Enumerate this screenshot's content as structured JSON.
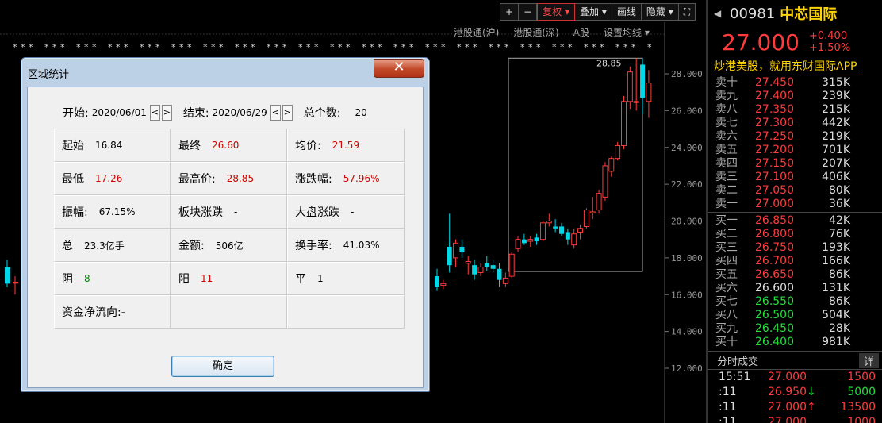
{
  "toolbar": {
    "plus": "+",
    "minus": "−",
    "fuquan": "复权",
    "diejia": "叠加",
    "huaxian": "画线",
    "yincang": "隐藏",
    "fullscreen_icon": "fullscreen-icon"
  },
  "chart_sub": {
    "hk_sh": "港股通(沪)",
    "hk_sz": "港股通(深)",
    "a_share": "A股",
    "set_ma": "设置均线"
  },
  "chart_data": {
    "type": "candlestick",
    "y_ticks": [
      "28.000",
      "26.000",
      "24.000",
      "22.000",
      "20.000",
      "18.000",
      "16.000",
      "14.000",
      "12.000"
    ],
    "ylim": [
      12,
      28.85
    ],
    "high_label": "28.85",
    "up_color": "#ff3b3b",
    "down_color": "#00d8e8",
    "candles": [
      {
        "o": 17.0,
        "h": 17.4,
        "l": 16.2,
        "c": 16.4
      },
      {
        "o": 16.5,
        "h": 16.8,
        "l": 16.3,
        "c": 16.6
      },
      {
        "o": 18.6,
        "h": 20.4,
        "l": 17.2,
        "c": 17.6
      },
      {
        "o": 18.0,
        "h": 19.0,
        "l": 17.5,
        "c": 18.8
      },
      {
        "o": 18.6,
        "h": 19.0,
        "l": 18.0,
        "c": 18.3
      },
      {
        "o": 17.7,
        "h": 18.1,
        "l": 17.1,
        "c": 17.8
      },
      {
        "o": 17.6,
        "h": 17.9,
        "l": 16.8,
        "c": 17.1
      },
      {
        "o": 17.2,
        "h": 17.7,
        "l": 17.0,
        "c": 17.5
      },
      {
        "o": 17.7,
        "h": 18.1,
        "l": 17.3,
        "c": 17.5
      },
      {
        "o": 17.6,
        "h": 17.9,
        "l": 17.2,
        "c": 17.4
      },
      {
        "o": 17.4,
        "h": 17.7,
        "l": 16.4,
        "c": 16.8
      },
      {
        "o": 16.6,
        "h": 17.2,
        "l": 16.4,
        "c": 16.9
      },
      {
        "o": 17.0,
        "h": 18.3,
        "l": 16.9,
        "c": 18.2
      },
      {
        "o": 18.5,
        "h": 19.2,
        "l": 18.3,
        "c": 19.0
      },
      {
        "o": 19.0,
        "h": 19.3,
        "l": 18.7,
        "c": 18.8
      },
      {
        "o": 18.9,
        "h": 19.2,
        "l": 18.6,
        "c": 19.0
      },
      {
        "o": 19.1,
        "h": 19.3,
        "l": 18.7,
        "c": 18.9
      },
      {
        "o": 19.0,
        "h": 20.0,
        "l": 18.9,
        "c": 19.9
      },
      {
        "o": 19.9,
        "h": 20.4,
        "l": 19.7,
        "c": 20.0
      },
      {
        "o": 19.7,
        "h": 20.1,
        "l": 19.4,
        "c": 19.6
      },
      {
        "o": 19.7,
        "h": 19.9,
        "l": 19.2,
        "c": 19.3
      },
      {
        "o": 19.4,
        "h": 19.6,
        "l": 18.7,
        "c": 19.0
      },
      {
        "o": 18.7,
        "h": 19.6,
        "l": 18.5,
        "c": 19.3
      },
      {
        "o": 19.4,
        "h": 19.8,
        "l": 19.0,
        "c": 19.6
      },
      {
        "o": 19.7,
        "h": 20.7,
        "l": 19.6,
        "c": 20.6
      },
      {
        "o": 20.5,
        "h": 21.3,
        "l": 20.1,
        "c": 20.5
      },
      {
        "o": 20.6,
        "h": 21.7,
        "l": 20.4,
        "c": 21.5
      },
      {
        "o": 21.3,
        "h": 23.2,
        "l": 21.1,
        "c": 23.0
      },
      {
        "o": 22.7,
        "h": 23.5,
        "l": 22.4,
        "c": 23.4
      },
      {
        "o": 23.4,
        "h": 24.3,
        "l": 23.3,
        "c": 24.1
      },
      {
        "o": 24.1,
        "h": 26.8,
        "l": 23.9,
        "c": 26.5
      },
      {
        "o": 26.5,
        "h": 28.4,
        "l": 26.1,
        "c": 28.1
      },
      {
        "o": 26.5,
        "h": 28.85,
        "l": 26.0,
        "c": 26.5
      },
      {
        "o": 28.5,
        "h": 28.85,
        "l": 25.8,
        "c": 26.7
      },
      {
        "o": 26.5,
        "h": 28.2,
        "l": 25.6,
        "c": 27.5
      }
    ]
  },
  "quote": {
    "code": "00981",
    "name": "中芯国际",
    "price": "27.000",
    "change": "+0.400",
    "change_pct": "+1.50%",
    "ad": "炒港美股，就用东财国际APP",
    "sell": [
      {
        "label": "卖十",
        "price": "27.450",
        "vol": "315K"
      },
      {
        "label": "卖九",
        "price": "27.400",
        "vol": "239K"
      },
      {
        "label": "卖八",
        "price": "27.350",
        "vol": "215K"
      },
      {
        "label": "卖七",
        "price": "27.300",
        "vol": "442K"
      },
      {
        "label": "卖六",
        "price": "27.250",
        "vol": "219K"
      },
      {
        "label": "卖五",
        "price": "27.200",
        "vol": "701K"
      },
      {
        "label": "卖四",
        "price": "27.150",
        "vol": "207K"
      },
      {
        "label": "卖三",
        "price": "27.100",
        "vol": "406K"
      },
      {
        "label": "卖二",
        "price": "27.050",
        "vol": "80K"
      },
      {
        "label": "卖一",
        "price": "27.000",
        "vol": "36K"
      }
    ],
    "buy": [
      {
        "label": "买一",
        "price": "26.850",
        "vol": "42K"
      },
      {
        "label": "买二",
        "price": "26.800",
        "vol": "76K"
      },
      {
        "label": "买三",
        "price": "26.750",
        "vol": "193K"
      },
      {
        "label": "买四",
        "price": "26.700",
        "vol": "166K"
      },
      {
        "label": "买五",
        "price": "26.650",
        "vol": "86K"
      },
      {
        "label": "买六",
        "price": "26.600",
        "vol": "131K"
      },
      {
        "label": "买七",
        "price": "26.550",
        "vol": "86K"
      },
      {
        "label": "买八",
        "price": "26.500",
        "vol": "504K"
      },
      {
        "label": "买九",
        "price": "26.450",
        "vol": "28K"
      },
      {
        "label": "买十",
        "price": "26.400",
        "vol": "981K"
      }
    ],
    "trades_title": "分时成交",
    "trades_detail": "详",
    "trades": [
      {
        "time": "15:51",
        "price": "27.000",
        "vol": "1500",
        "arrow": ""
      },
      {
        "time": ":11",
        "price": "26.950",
        "vol": "5000",
        "arrow": "↓"
      },
      {
        "time": ":11",
        "price": "27.000",
        "vol": "13500",
        "arrow": "↑"
      },
      {
        "time": ":11",
        "price": "27.000",
        "vol": "1000",
        "arrow": ""
      }
    ]
  },
  "dialog": {
    "title": "区域统计",
    "close": "✕",
    "start_label": "开始:",
    "start_value": "2020/06/01",
    "end_label": "结束:",
    "end_value": "2020/06/29",
    "count_label": "总个数:",
    "count_value": "20",
    "prev": "<",
    "next": ">",
    "stats": [
      {
        "label": "起始",
        "value": "16.84",
        "color": ""
      },
      {
        "label": "最终",
        "value": "26.60",
        "color": "red"
      },
      {
        "label": "均价:",
        "value": "21.59",
        "color": "red"
      },
      {
        "label": "最低",
        "value": "17.26",
        "color": "red"
      },
      {
        "label": "最高价:",
        "value": "28.85",
        "color": "red"
      },
      {
        "label": "涨跌幅:",
        "value": "57.96%",
        "color": "red"
      },
      {
        "label": "振幅:",
        "value": "67.15%",
        "color": ""
      },
      {
        "label": "板块涨跌",
        "value": "-",
        "color": ""
      },
      {
        "label": "大盘涨跌",
        "value": "-",
        "color": ""
      },
      {
        "label": "总",
        "value": "23.3亿手",
        "color": ""
      },
      {
        "label": "金额:",
        "value": "506亿",
        "color": ""
      },
      {
        "label": "换手率:",
        "value": "41.03%",
        "color": ""
      },
      {
        "label": "阴",
        "value": "8",
        "color": "green"
      },
      {
        "label": "阳",
        "value": "11",
        "color": "red"
      },
      {
        "label": "平",
        "value": "1",
        "color": ""
      },
      {
        "label": "资金净流向:-",
        "value": "",
        "color": ""
      },
      {
        "label": "",
        "value": "",
        "color": ""
      },
      {
        "label": "",
        "value": "",
        "color": ""
      }
    ],
    "ok": "确定"
  }
}
